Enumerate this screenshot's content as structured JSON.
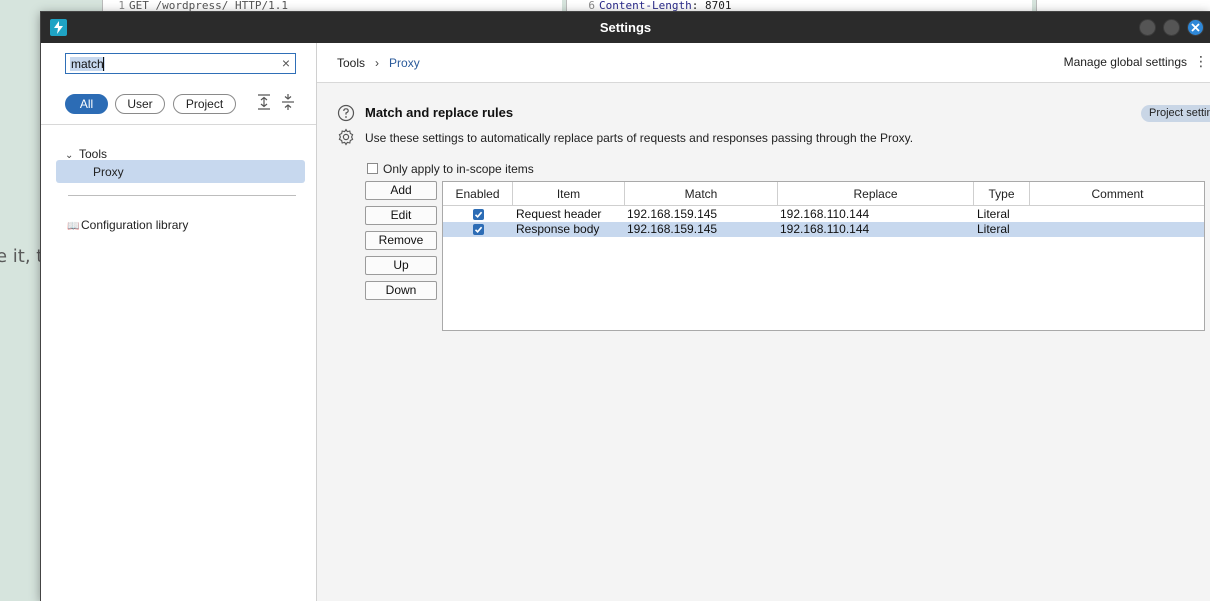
{
  "background": {
    "editor_left": {
      "line_no": "1",
      "text": "GET /wordpress/ HTTP/1.1"
    },
    "editor_right": {
      "line_no": "6",
      "key": "Content-Length",
      "value": ": 8701"
    },
    "snippet": "e it, th"
  },
  "window": {
    "title": "Settings",
    "app_icon": "burp-lightning-icon"
  },
  "sidebar": {
    "search": {
      "value": "match"
    },
    "filters": [
      {
        "label": "All",
        "active": true
      },
      {
        "label": "User",
        "active": false
      },
      {
        "label": "Project",
        "active": false
      }
    ],
    "tree": {
      "group": "Tools",
      "item": "Proxy"
    },
    "config_library": "Configuration library"
  },
  "header": {
    "breadcrumb": [
      "Tools",
      "Proxy"
    ],
    "manage_label": "Manage global settings"
  },
  "section": {
    "title": "Match and replace rules",
    "badge": "Project settings",
    "description": "Use these settings to automatically replace parts of requests and responses passing through the Proxy.",
    "scope_label": "Only apply to in-scope items",
    "buttons": [
      "Add",
      "Edit",
      "Remove",
      "Up",
      "Down"
    ],
    "table": {
      "columns": [
        "Enabled",
        "Item",
        "Match",
        "Replace",
        "Type",
        "Comment"
      ],
      "rows": [
        {
          "enabled": true,
          "item": "Request header",
          "match": "192.168.159.145",
          "replace": "192.168.110.144",
          "type": "Literal",
          "comment": ""
        },
        {
          "enabled": true,
          "item": "Response body",
          "match": "192.168.159.145",
          "replace": "192.168.110.144",
          "type": "Literal",
          "comment": "",
          "selected": true
        }
      ]
    }
  },
  "colors": {
    "accent": "#2c6cb5",
    "selection": "#c7d8ee",
    "titlebar": "#2b2b2b"
  }
}
